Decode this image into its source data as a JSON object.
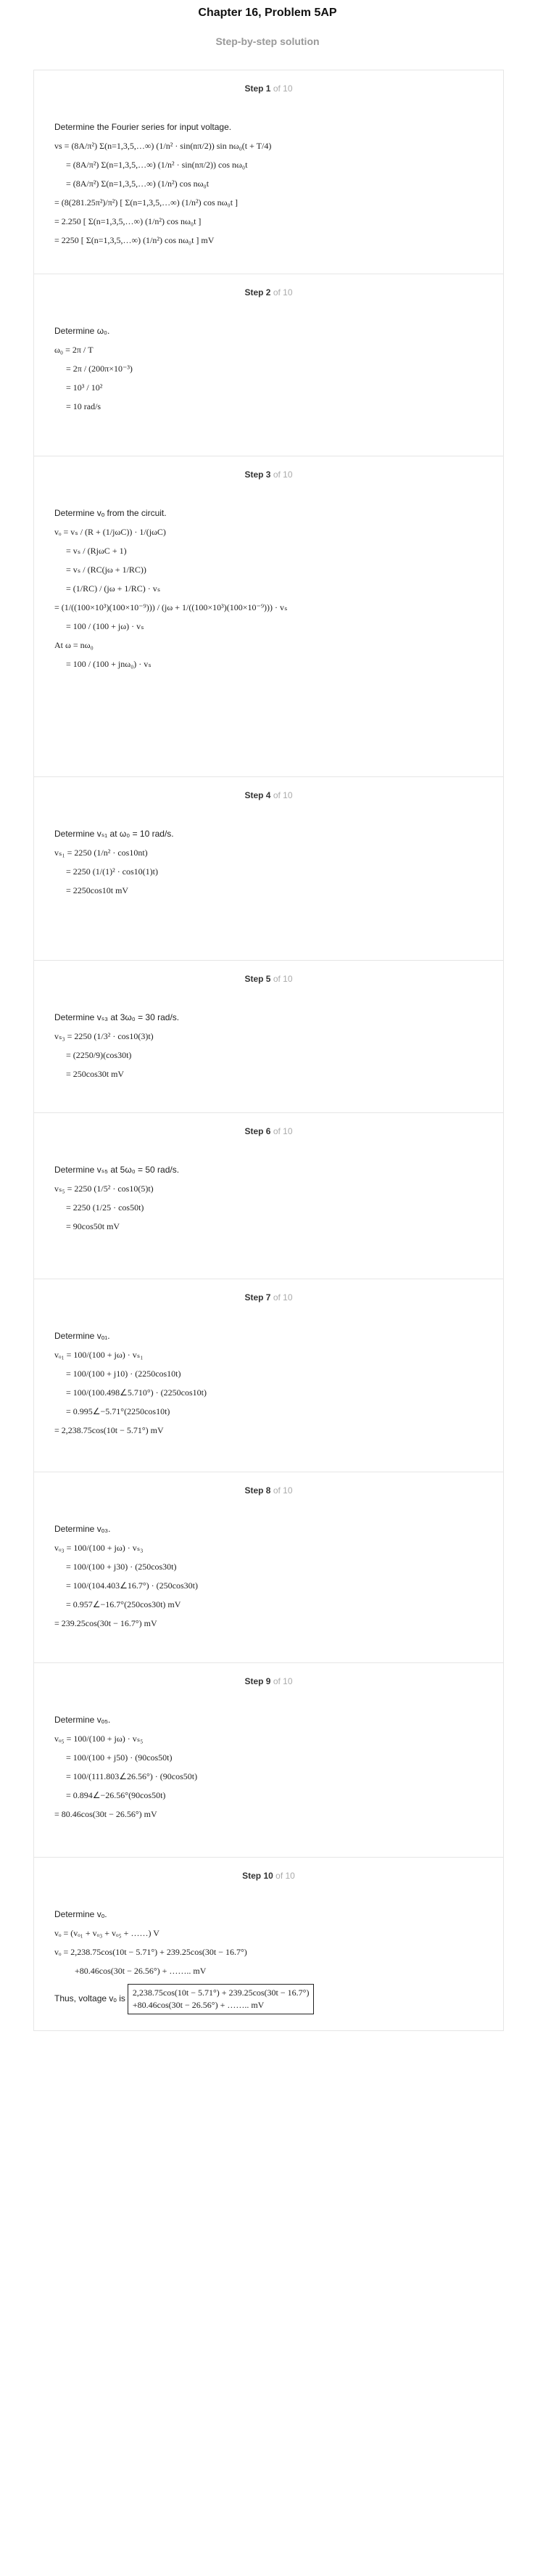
{
  "header": {
    "title": "Chapter 16, Problem 5AP",
    "subtitle": "Step-by-step solution"
  },
  "steps": [
    {
      "label": "Step 1",
      "of": "of 10",
      "intro": "Determine the Fourier series for input voltage.",
      "lines": [
        "vs = (8A/π²) Σ(n=1,3,5,…∞) (1/n² · sin(nπ/2)) sin nω₀(t + T/4)",
        "= (8A/π²) Σ(n=1,3,5,…∞) (1/n² · sin(nπ/2)) cos nω₀t",
        "= (8A/π²) Σ(n=1,3,5,…∞) (1/n²) cos nω₀t",
        "= (8(281.25π²)/π²) [ Σ(n=1,3,5,…∞) (1/n²) cos nω₀t ]",
        "= 2.250 [ Σ(n=1,3,5,…∞) (1/n²) cos nω₀t ]",
        "= 2250 [ Σ(n=1,3,5,…∞) (1/n²) cos nω₀t ] mV"
      ]
    },
    {
      "label": "Step 2",
      "of": "of 10",
      "intro": "Determine ω₀.",
      "lines": [
        "ω₀ = 2π / T",
        "= 2π / (200π×10⁻³)",
        "= 10³ / 10²",
        "= 10 rad/s"
      ]
    },
    {
      "label": "Step 3",
      "of": "of 10",
      "intro": "Determine vₒ from the circuit.",
      "lines": [
        "vₒ = vₛ / (R + (1/jωC)) · 1/(jωC)",
        "= vₛ / (RjωC + 1)",
        "= vₛ / (RC(jω + 1/RC))",
        "= (1/RC) / (jω + 1/RC) · vₛ",
        "= (1/((100×10³)(100×10⁻⁹))) / (jω + 1/((100×10³)(100×10⁻⁹))) · vₛ",
        "= 100 / (100 + jω) · vₛ",
        "At ω = nω₀",
        "= 100 / (100 + jnω₀) · vₛ"
      ]
    },
    {
      "label": "Step 4",
      "of": "of 10",
      "intro": "Determine vₛ₁ at ω₀ = 10 rad/s.",
      "lines": [
        "vₛ₁ = 2250 (1/n² · cos10nt)",
        "= 2250 (1/(1)² · cos10(1)t)",
        "= 2250cos10t mV"
      ]
    },
    {
      "label": "Step 5",
      "of": "of 10",
      "intro": "Determine vₛ₃ at 3ω₀ = 30 rad/s.",
      "lines": [
        "vₛ₃ = 2250 (1/3² · cos10(3)t)",
        "= (2250/9)(cos30t)",
        "= 250cos30t mV"
      ]
    },
    {
      "label": "Step 6",
      "of": "of 10",
      "intro": "Determine vₛ₅ at 5ω₀ = 50 rad/s.",
      "lines": [
        "vₛ₅ = 2250 (1/5² · cos10(5)t)",
        "= 2250 (1/25 · cos50t)",
        "= 90cos50t mV"
      ]
    },
    {
      "label": "Step 7",
      "of": "of 10",
      "intro": "Determine vₒ₁.",
      "lines": [
        "vₒ₁ = 100/(100 + jω) · vₛ₁",
        "= 100/(100 + j10) · (2250cos10t)",
        "= 100/(100.498∠5.710°) · (2250cos10t)",
        "= 0.995∠−5.71°(2250cos10t)",
        "= 2,238.75cos(10t − 5.71°) mV"
      ]
    },
    {
      "label": "Step 8",
      "of": "of 10",
      "intro": "Determine vₒ₃.",
      "lines": [
        "vₒ₃ = 100/(100 + jω) · vₛ₃",
        "= 100/(100 + j30) · (250cos30t)",
        "= 100/(104.403∠16.7°) · (250cos30t)",
        "= 0.957∠−16.7°(250cos30t) mV",
        "= 239.25cos(30t − 16.7°) mV"
      ]
    },
    {
      "label": "Step 9",
      "of": "of 10",
      "intro": "Determine vₒ₅.",
      "lines": [
        "vₒ₅ = 100/(100 + jω) · vₛ₅",
        "= 100/(100 + j50) · (90cos50t)",
        "= 100/(111.803∠26.56°) · (90cos50t)",
        "= 0.894∠−26.56°(90cos50t)",
        "= 80.46cos(30t − 26.56°) mV"
      ]
    },
    {
      "label": "Step 10",
      "of": "of 10",
      "intro": "Determine vₒ.",
      "lines": [
        "vₒ = (vₒ₁ + vₒ₃ + vₒ₅ + ……) V",
        "vₒ = 2,238.75cos(10t − 5.71°) + 239.25cos(30t − 16.7°)",
        "+80.46cos(30t − 26.56°) + …….. mV"
      ],
      "final_label": "Thus, voltage vₒ is",
      "final_box_1": "2,238.75cos(10t − 5.71°) + 239.25cos(30t − 16.7°)",
      "final_box_2": "+80.46cos(30t − 26.56°) + …….. mV"
    }
  ]
}
